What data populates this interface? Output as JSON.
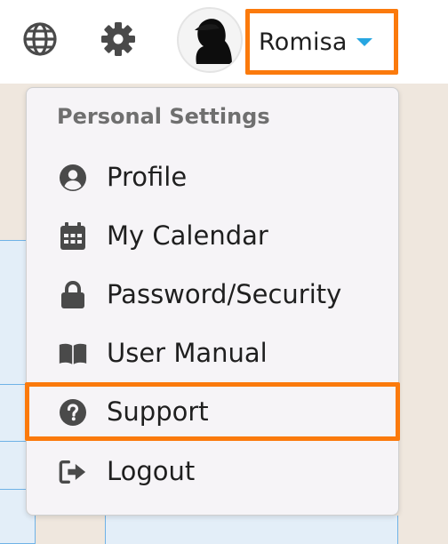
{
  "topbar": {
    "language_icon": "globe-icon",
    "settings_icon": "gear-icon",
    "user": {
      "name": "Romisa",
      "avatar": "user-avatar"
    }
  },
  "menu": {
    "header": "Personal Settings",
    "items": [
      {
        "label": "Profile",
        "icon": "user-circle-icon"
      },
      {
        "label": "My Calendar",
        "icon": "calendar-icon"
      },
      {
        "label": "Password/Security",
        "icon": "lock-icon"
      },
      {
        "label": "User Manual",
        "icon": "book-icon"
      },
      {
        "label": "Support",
        "icon": "question-circle-icon"
      },
      {
        "label": "Logout",
        "icon": "logout-icon"
      }
    ]
  },
  "colors": {
    "highlight": "#fb7a0c",
    "caret": "#27a6e1",
    "icon": "#4a4a4a",
    "page_bg": "#efe7de",
    "grid_line": "#6fb2e6"
  }
}
